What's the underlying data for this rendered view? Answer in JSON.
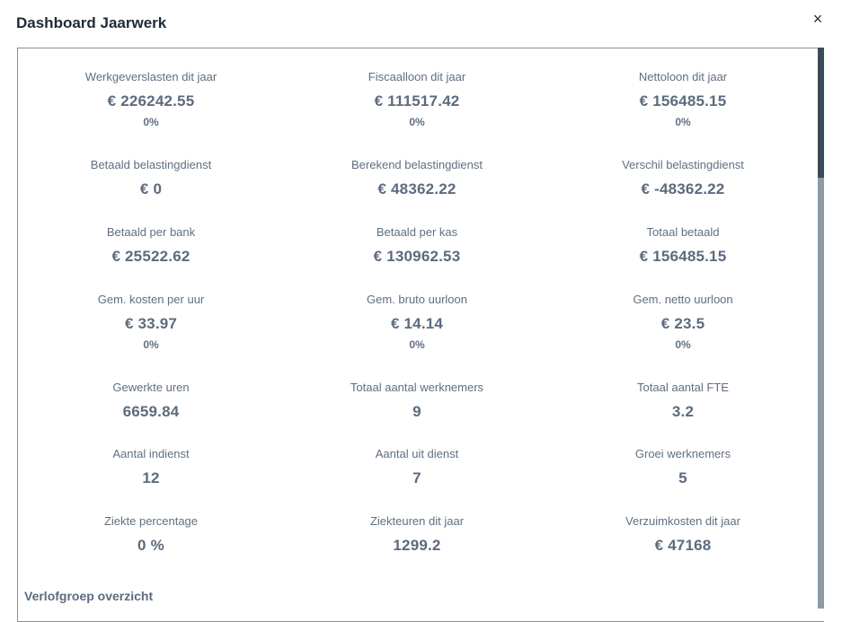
{
  "dialog": {
    "title": "Dashboard Jaarwerk",
    "close_symbol": "×"
  },
  "stats": [
    {
      "label": "Werkgeverslasten dit jaar",
      "value": "€ 226242.55",
      "percent": "0%"
    },
    {
      "label": "Fiscaalloon dit jaar",
      "value": "€ 111517.42",
      "percent": "0%"
    },
    {
      "label": "Nettoloon dit jaar",
      "value": "€ 156485.15",
      "percent": "0%"
    },
    {
      "label": "Betaald belastingdienst",
      "value": "€ 0"
    },
    {
      "label": "Berekend belastingdienst",
      "value": "€ 48362.22"
    },
    {
      "label": "Verschil belastingdienst",
      "value": "€ -48362.22"
    },
    {
      "label": "Betaald per bank",
      "value": "€ 25522.62"
    },
    {
      "label": "Betaald per kas",
      "value": "€ 130962.53"
    },
    {
      "label": "Totaal betaald",
      "value": "€ 156485.15"
    },
    {
      "label": "Gem. kosten per uur",
      "value": "€ 33.97",
      "percent": "0%"
    },
    {
      "label": "Gem. bruto uurloon",
      "value": "€ 14.14",
      "percent": "0%"
    },
    {
      "label": "Gem. netto uurloon",
      "value": "€ 23.5",
      "percent": "0%"
    },
    {
      "label": "Gewerkte uren",
      "value": "6659.84"
    },
    {
      "label": "Totaal aantal werknemers",
      "value": "9"
    },
    {
      "label": "Totaal aantal FTE",
      "value": "3.2"
    },
    {
      "label": "Aantal indienst",
      "value": "12"
    },
    {
      "label": "Aantal uit dienst",
      "value": "7"
    },
    {
      "label": "Groei werknemers",
      "value": "5"
    },
    {
      "label": "Ziekte percentage",
      "value": "0 %"
    },
    {
      "label": "Ziekteuren dit jaar",
      "value": "1299.2"
    },
    {
      "label": "Verzuimkosten dit jaar",
      "value": "€ 47168"
    }
  ],
  "section": {
    "title": "Verlofgroep overzicht"
  },
  "icons": {
    "close": "close-icon"
  },
  "colors": {
    "label": "#5f6f82",
    "value": "#5c6b7e",
    "title": "#1f2a37",
    "scrollbar_track": "#8e9aa6",
    "scrollbar_thumb": "#3d4a58"
  }
}
